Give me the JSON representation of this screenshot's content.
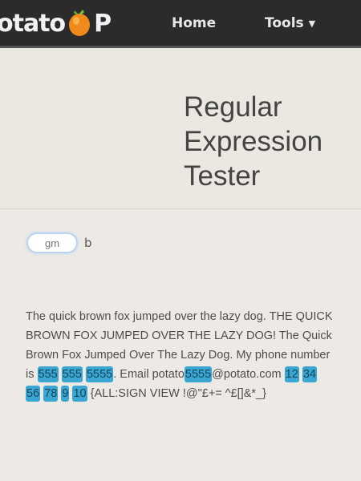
{
  "header": {
    "logo_text_left": "otato",
    "logo_text_right": "P",
    "nav": {
      "home_label": "Home",
      "tools_label": "Tools"
    }
  },
  "hero": {
    "title": "Regular Expression Tester"
  },
  "regex": {
    "flags_value": "",
    "flags_placeholder": "gm",
    "flags_suffix": "b"
  },
  "test_text": {
    "segments": [
      {
        "text": "The quick brown fox jumped over the lazy dog. THE QUICK BROWN FOX JUMPED OVER THE LAZY DOG! The Quick Brown Fox Jumped Over The Lazy Dog. My phone number is ",
        "match": false
      },
      {
        "text": "555",
        "match": true
      },
      {
        "text": " ",
        "match": false
      },
      {
        "text": "555",
        "match": true
      },
      {
        "text": " ",
        "match": false
      },
      {
        "text": "5555",
        "match": true
      },
      {
        "text": ". Email potato",
        "match": false
      },
      {
        "text": "5555",
        "match": true
      },
      {
        "text": "@potato.com ",
        "match": false
      },
      {
        "text": "12",
        "match": true
      },
      {
        "text": " ",
        "match": false
      },
      {
        "text": "34",
        "match": true
      },
      {
        "text": " ",
        "match": false
      },
      {
        "text": "56",
        "match": true
      },
      {
        "text": " ",
        "match": false
      },
      {
        "text": "78",
        "match": true
      },
      {
        "text": " ",
        "match": false
      },
      {
        "text": "9",
        "match": true
      },
      {
        "text": " ",
        "match": false
      },
      {
        "text": "10",
        "match": true
      },
      {
        "text": " {ALL:SIGN VIEW !@\"£+= ^£[]&*_}",
        "match": false
      }
    ]
  },
  "colors": {
    "topbar": "#2b2b2b",
    "match_highlight": "#3aa7d3",
    "logo_accent": "#f08a1c"
  }
}
